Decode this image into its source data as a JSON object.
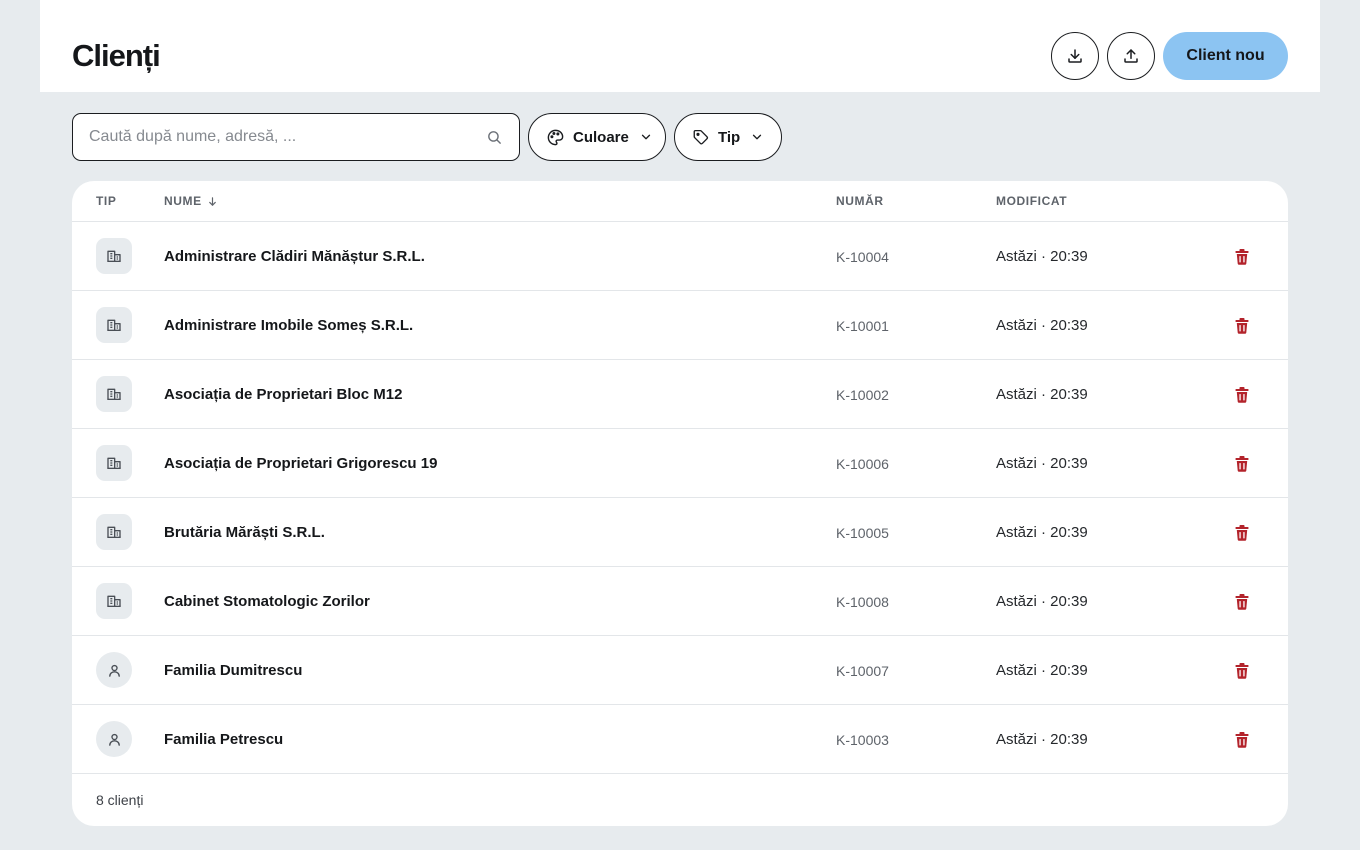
{
  "header": {
    "title": "Clienți",
    "new_button_label": "Client nou"
  },
  "filters": {
    "search_placeholder": "Caută după nume, adresă, ...",
    "search_value": "",
    "color_label": "Culoare",
    "type_label": "Tip"
  },
  "table": {
    "columns": {
      "type": "TIP",
      "name": "NUME",
      "number": "NUMĂR",
      "modified": "MODIFICAT"
    },
    "rows": [
      {
        "kind": "company",
        "name": "Administrare Clădiri Mănăștur S.R.L.",
        "number": "K-10004",
        "modified": "Astăzi · 20:39"
      },
      {
        "kind": "company",
        "name": "Administrare Imobile Someș S.R.L.",
        "number": "K-10001",
        "modified": "Astăzi · 20:39"
      },
      {
        "kind": "company",
        "name": "Asociația de Proprietari Bloc M12",
        "number": "K-10002",
        "modified": "Astăzi · 20:39"
      },
      {
        "kind": "company",
        "name": "Asociația de Proprietari Grigorescu 19",
        "number": "K-10006",
        "modified": "Astăzi · 20:39"
      },
      {
        "kind": "company",
        "name": "Brutăria Mărăști S.R.L.",
        "number": "K-10005",
        "modified": "Astăzi · 20:39"
      },
      {
        "kind": "company",
        "name": "Cabinet Stomatologic Zorilor",
        "number": "K-10008",
        "modified": "Astăzi · 20:39"
      },
      {
        "kind": "person",
        "name": "Familia Dumitrescu",
        "number": "K-10007",
        "modified": "Astăzi · 20:39"
      },
      {
        "kind": "person",
        "name": "Familia Petrescu",
        "number": "K-10003",
        "modified": "Astăzi · 20:39"
      }
    ],
    "footer": "8 clienți"
  },
  "icons": {
    "download": "download-icon",
    "upload": "upload-icon",
    "search": "search-icon",
    "palette": "palette-icon",
    "tag": "tag-icon",
    "chevron": "chevron-down-icon",
    "sort": "arrow-down-icon",
    "company": "building-icon",
    "person": "person-icon",
    "delete": "trash-icon"
  },
  "colors": {
    "background": "#e7ebee",
    "primary": "#8cc4f2",
    "danger": "#b3232b",
    "badge": "#e7ebee"
  }
}
